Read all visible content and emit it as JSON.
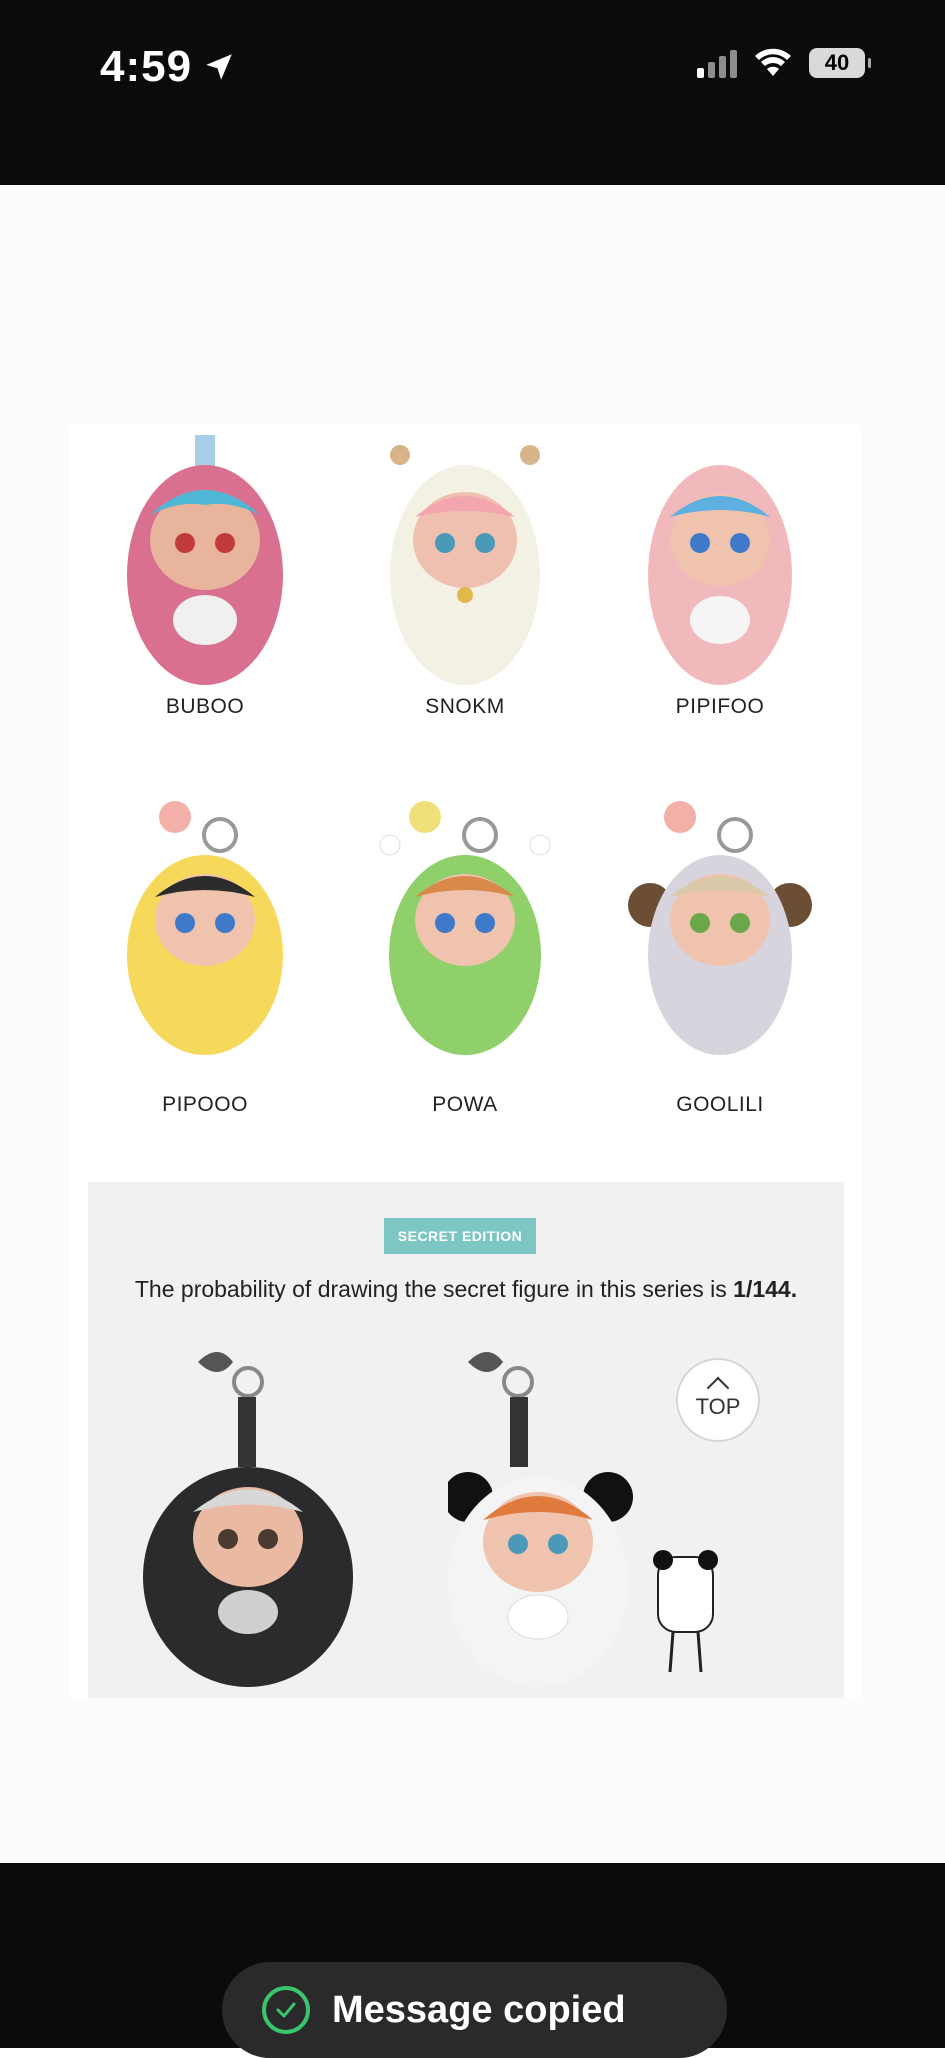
{
  "status_bar": {
    "time": "4:59",
    "battery": "40"
  },
  "products": [
    {
      "name": "BUBOO"
    },
    {
      "name": "SNOKM"
    },
    {
      "name": "PIPIFOO"
    },
    {
      "name": "PIPOOO"
    },
    {
      "name": "POWA"
    },
    {
      "name": "GOOLILI"
    }
  ],
  "secret": {
    "badge": "SECRET EDITION",
    "prob_prefix": "The probability of drawing the secret figure in this series is",
    "prob_value": "1/144."
  },
  "top_button": {
    "label": "TOP"
  },
  "toast": {
    "text": "Message copied"
  },
  "colors": {
    "accent": "#7cc7c3",
    "status_bg": "#0b0b0b",
    "toast_check": "#3ac46b"
  }
}
